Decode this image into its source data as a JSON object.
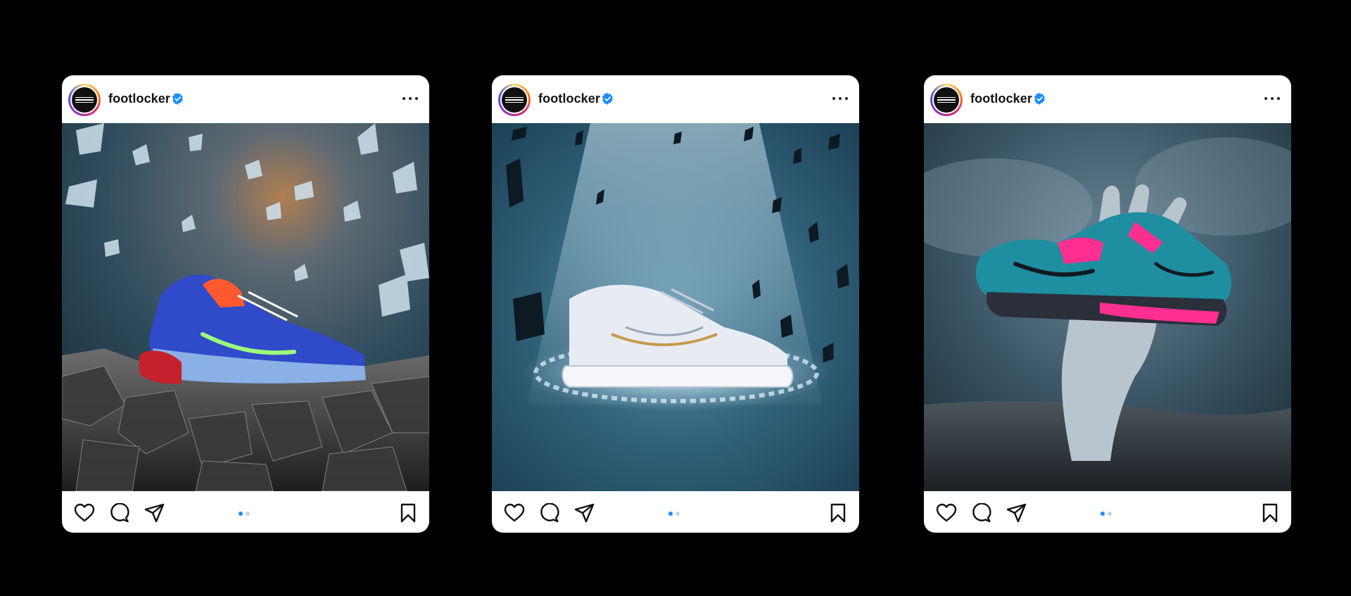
{
  "accent_color": "#0095f6",
  "posts": [
    {
      "username": "footlocker",
      "avatar_logo_text": "Foot Locker",
      "verified_icon": "verified-badge-icon",
      "menu_icon": "more-horizontal-icon",
      "image_description_icon": "sneaker-on-rocks-photo",
      "carousel": {
        "total": 2,
        "active": 1
      },
      "actions": [
        "heart-icon",
        "comment-icon",
        "send-icon",
        "bookmark-icon"
      ]
    },
    {
      "username": "footlocker",
      "avatar_logo_text": "Foot Locker",
      "verified_icon": "verified-badge-icon",
      "menu_icon": "more-horizontal-icon",
      "image_description_icon": "white-sneaker-spotlight-photo",
      "carousel": {
        "total": 2,
        "active": 1
      },
      "actions": [
        "heart-icon",
        "comment-icon",
        "send-icon",
        "bookmark-icon"
      ]
    },
    {
      "username": "footlocker",
      "avatar_logo_text": "Foot Locker",
      "verified_icon": "verified-badge-icon",
      "menu_icon": "more-horizontal-icon",
      "image_description_icon": "hand-holding-sneaker-photo",
      "carousel": {
        "total": 2,
        "active": 1
      },
      "actions": [
        "heart-icon",
        "comment-icon",
        "send-icon",
        "bookmark-icon"
      ]
    }
  ]
}
